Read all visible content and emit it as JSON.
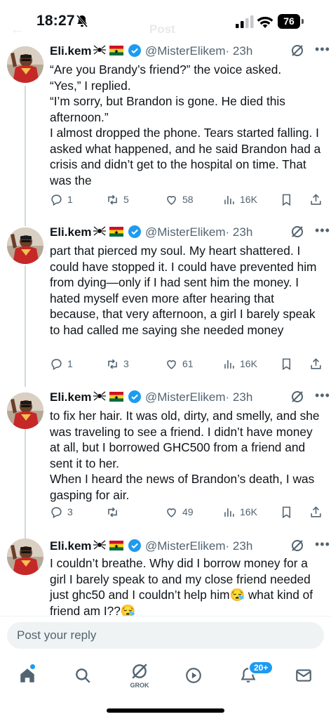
{
  "status_bar": {
    "time": "18:27",
    "battery": "76",
    "ghost_title": "Post",
    "icons": [
      "bell-slash-icon",
      "signal-icon",
      "wifi-icon",
      "battery-icon"
    ]
  },
  "author": {
    "name": "Eli.kem",
    "handle": "@MisterElikem",
    "time": "· 23h",
    "badges": [
      "spider-icon",
      "ghana-flag-icon",
      "verified-icon"
    ]
  },
  "tweets": [
    {
      "text": "“Are you Brandy’s friend?” the voice asked.\n“Yes,” I replied.\n“I’m sorry, but Brandon is gone. He died this afternoon.”\nI almost dropped the phone. Tears started falling. I asked what happened, and he said Brandon had a crisis and didn’t get to the hospital on time. That was the",
      "replies": "1",
      "reposts": "5",
      "likes": "58",
      "views": "16K"
    },
    {
      "text": "part that pierced my soul. My heart shattered. I could have stopped it. I could have prevented him from dying—only if I had sent him the money. I hated myself even more after hearing that because, that very afternoon, a girl I barely speak to had called me saying she needed money",
      "replies": "1",
      "reposts": "3",
      "likes": "61",
      "views": "16K"
    },
    {
      "text": "to fix her hair. It was old, dirty, and smelly, and she was traveling to see a friend. I didn’t have money at all, but I borrowed GHC500 from a friend and sent it to her.\nWhen I heard the news of Brandon’s death, I was gasping for air.",
      "replies": "3",
      "reposts": "",
      "likes": "49",
      "views": "16K"
    },
    {
      "text": "I couldn’t breathe. Why did I borrow money for a girl I barely speak to and my close friend needed just ghc50 and I couldn’t help him😪 what kind of friend am I??😪",
      "replies": "",
      "reposts": "",
      "likes": "",
      "views": ""
    }
  ],
  "reply_box": {
    "placeholder": "Post your reply"
  },
  "nav": {
    "items": [
      "home-icon",
      "search-icon",
      "grok-icon",
      "video-icon",
      "notifications-icon",
      "messages-icon"
    ],
    "grok_label": "GROK",
    "notifications_badge": "20+"
  },
  "colors": {
    "accent": "#1d9bf0",
    "muted": "#536471",
    "text": "#0f1419"
  }
}
